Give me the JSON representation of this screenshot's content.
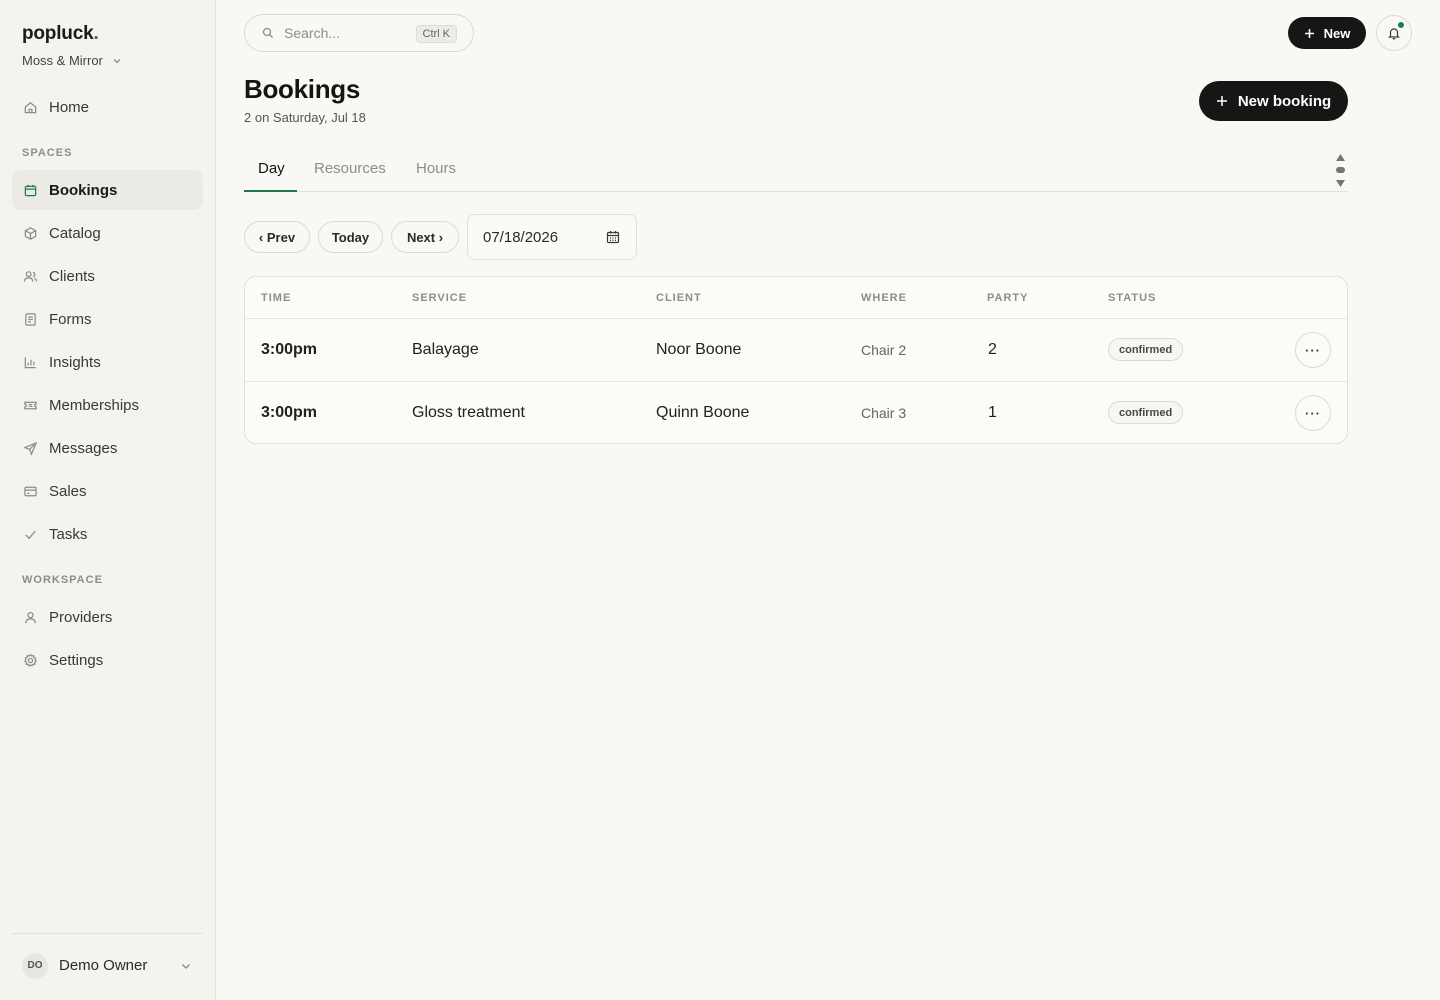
{
  "app": {
    "brand": "popluck",
    "brand_dot": ".",
    "workspace": "Moss & Mirror",
    "accent_color": "#1f7a4a"
  },
  "sidebar": {
    "home": {
      "label": "Home",
      "icon": "home-icon"
    },
    "spaces_label": "SPACES",
    "spaces": [
      {
        "label": "Bookings",
        "icon": "calendar-icon",
        "active": true
      },
      {
        "label": "Catalog",
        "icon": "box-icon"
      },
      {
        "label": "Clients",
        "icon": "users-icon"
      },
      {
        "label": "Forms",
        "icon": "form-icon"
      },
      {
        "label": "Insights",
        "icon": "bar-chart-icon"
      },
      {
        "label": "Memberships",
        "icon": "ticket-icon"
      },
      {
        "label": "Messages",
        "icon": "send-icon"
      },
      {
        "label": "Sales",
        "icon": "credit-card-icon"
      },
      {
        "label": "Tasks",
        "icon": "check-icon"
      }
    ],
    "workspace_label": "WORKSPACE",
    "workspace_items": [
      {
        "label": "Providers",
        "icon": "user-icon"
      },
      {
        "label": "Settings",
        "icon": "gear-icon"
      }
    ],
    "user": {
      "initials": "DO",
      "name": "Demo Owner"
    }
  },
  "topbar": {
    "search_placeholder": "Search...",
    "search_shortcut": "Ctrl K",
    "new_label": "New"
  },
  "header": {
    "title": "Bookings",
    "subtitle": "2 on Saturday, Jul 18",
    "new_booking_label": "New booking"
  },
  "tabs": [
    {
      "label": "Day",
      "active": true
    },
    {
      "label": "Resources"
    },
    {
      "label": "Hours"
    }
  ],
  "controls": {
    "prev_label": "‹ Prev",
    "today_label": "Today",
    "next_label": "Next ›",
    "date_value": "07/18/2026"
  },
  "table": {
    "columns": [
      "TIME",
      "SERVICE",
      "CLIENT",
      "WHERE",
      "PARTY",
      "STATUS"
    ],
    "rows": [
      {
        "time": "3:00pm",
        "service": "Balayage",
        "client": "Noor Boone",
        "where": "Chair 2",
        "party": "2",
        "status": "confirmed",
        "actions": "···"
      },
      {
        "time": "3:00pm",
        "service": "Gloss treatment",
        "client": "Quinn Boone",
        "where": "Chair 3",
        "party": "1",
        "status": "confirmed",
        "actions": "···"
      }
    ]
  }
}
